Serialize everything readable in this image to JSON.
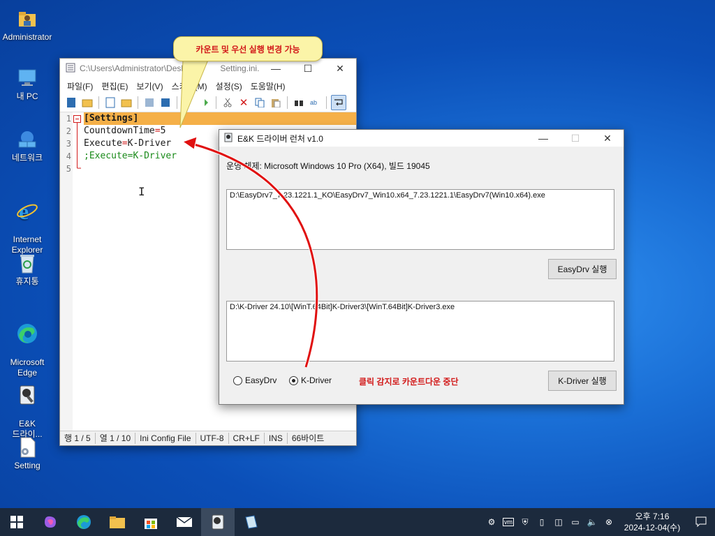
{
  "desktop": {
    "icons": [
      {
        "label": "Administrator",
        "icon": "user-folder-icon"
      },
      {
        "label": "내 PC",
        "icon": "pc-icon"
      },
      {
        "label": "네트워크",
        "icon": "network-icon"
      },
      {
        "label": "Internet\nExplorer",
        "icon": "ie-icon"
      },
      {
        "label": "휴지통",
        "icon": "recycle-bin-icon"
      },
      {
        "label": "Microsoft\nEdge",
        "icon": "edge-icon"
      },
      {
        "label": "E&K\n드라이...",
        "icon": "ek-launcher-icon"
      },
      {
        "label": "Setting",
        "icon": "setting-file-icon"
      }
    ]
  },
  "callout": {
    "text": "카운트 및 우선 실행 변경 가능"
  },
  "notepad": {
    "title": "C:\\Users\\Administrator\\Deskto",
    "title_tail": "Setting.ini...",
    "menu": [
      "파일(F)",
      "편집(E)",
      "보기(V)",
      "스키마(M)",
      "설정(S)",
      "도움말(H)"
    ],
    "lines": [
      {
        "num": "1",
        "text": "[Settings]"
      },
      {
        "num": "2",
        "key": "CountdownTime",
        "eq": "=",
        "val": "5"
      },
      {
        "num": "3",
        "key": "Execute",
        "eq": "=",
        "val": "K-Driver"
      },
      {
        "num": "4",
        "comment": ";Execute=K-Driver"
      },
      {
        "num": "5",
        "text": ""
      }
    ],
    "status": {
      "pos": "행 1 / 5",
      "col": "열 1 / 10",
      "type": "Ini Config File",
      "encoding": "UTF-8",
      "eol": "CR+LF",
      "mode": "INS",
      "size": "66바이트"
    }
  },
  "launcher": {
    "title": "E&K 드라이버 런처 v1.0",
    "os_info": "운영 체제: Microsoft Windows 10 Pro (X64), 빌드 19045",
    "easydrv_path": "D:\\EasyDrv7_7.23.1221.1_KO\\EasyDrv7_Win10.x64_7.23.1221.1\\EasyDrv7(Win10.x64).exe",
    "easydrv_button": "EasyDrv 실행",
    "kdriver_path": "D:\\K-Driver 24.10\\[WinT.64Bit]K-Driver3\\[WinT.64Bit]K-Driver3.exe",
    "kdriver_button": "K-Driver 실행",
    "radio_easydrv": "EasyDrv",
    "radio_kdriver": "K-Driver",
    "selected": "K-Driver",
    "note": "클릭 감지로 카운트다운 중단"
  },
  "taskbar": {
    "time": "오후 7:16",
    "date": "2024-12-04(수)"
  }
}
